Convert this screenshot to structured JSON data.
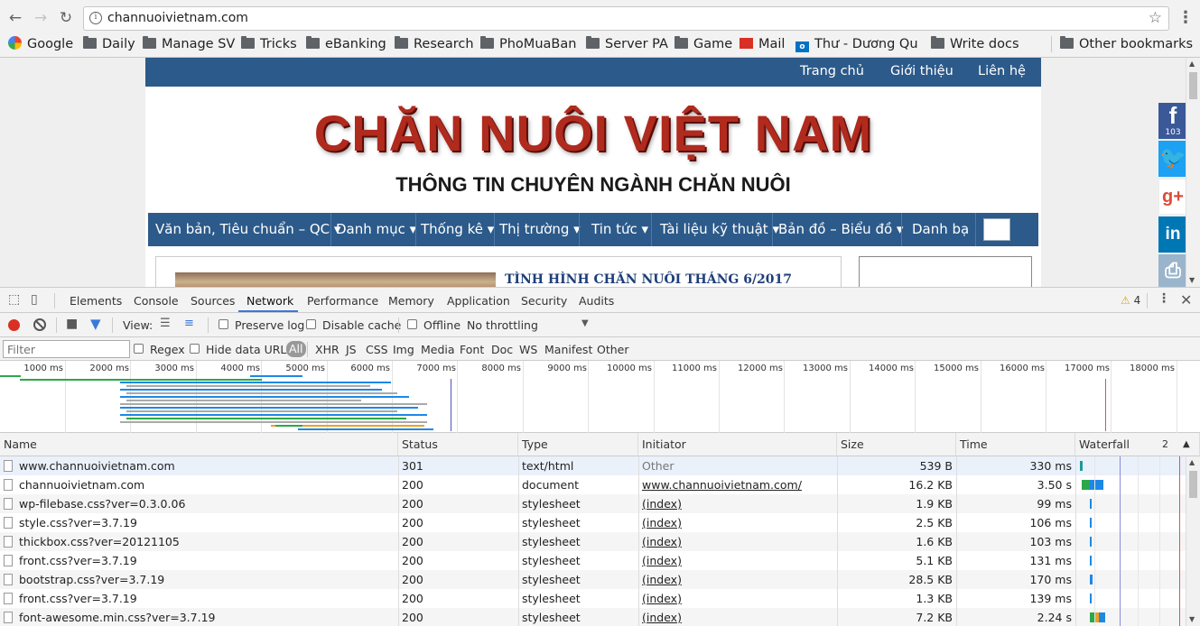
{
  "browser": {
    "url": "channuoivietnam.com",
    "bookmarks": [
      {
        "label": "Google",
        "icon": "google-icon"
      },
      {
        "label": "Daily",
        "icon": "folder-icon"
      },
      {
        "label": "Manage SV",
        "icon": "folder-icon"
      },
      {
        "label": "Tricks",
        "icon": "folder-icon"
      },
      {
        "label": "eBanking",
        "icon": "folder-icon"
      },
      {
        "label": "Research",
        "icon": "folder-icon"
      },
      {
        "label": "PhoMuaBan",
        "icon": "folder-icon"
      },
      {
        "label": "Server PA",
        "icon": "folder-icon"
      },
      {
        "label": "Game",
        "icon": "folder-icon"
      },
      {
        "label": "Mail",
        "icon": "gmail-icon"
      },
      {
        "label": "Thư - Dương Qu",
        "icon": "outlook-icon"
      },
      {
        "label": "Write docs",
        "icon": "folder-icon"
      }
    ],
    "other_bookmarks": "Other bookmarks"
  },
  "site": {
    "top_nav": [
      "Trang chủ",
      "Giới thiệu",
      "Liên hệ"
    ],
    "logo_title": "CHĂN NUÔI VIỆT NAM",
    "logo_subtitle": "THÔNG TIN CHUYÊN NGÀNH CHĂN NUÔI",
    "main_nav": [
      "Văn bản, Tiêu chuẩn – QC ▾",
      "Danh mục ▾",
      "Thống kê ▾",
      "Thị trường ▾",
      "Tin tức ▾",
      "Tài liệu kỹ thuật ▾",
      "Bản đồ – Biểu đồ ▾",
      "Danh bạ"
    ],
    "news_title": "TÌNH HÌNH CHĂN NUÔI THÁNG 6/2017",
    "social": {
      "facebook_count": "103"
    }
  },
  "devtools": {
    "tabs": [
      "Elements",
      "Console",
      "Sources",
      "Network",
      "Performance",
      "Memory",
      "Application",
      "Security",
      "Audits"
    ],
    "active_tab": "Network",
    "warning_count": "4",
    "toolbar": {
      "view_label": "View:",
      "preserve_log": "Preserve log",
      "disable_cache": "Disable cache",
      "offline": "Offline",
      "throttling": "No throttling"
    },
    "filter": {
      "placeholder": "Filter",
      "regex": "Regex",
      "hide_data_urls": "Hide data URLs",
      "types": [
        "All",
        "XHR",
        "JS",
        "CSS",
        "Img",
        "Media",
        "Font",
        "Doc",
        "WS",
        "Manifest",
        "Other"
      ]
    },
    "overview_ticks": [
      "1000 ms",
      "2000 ms",
      "3000 ms",
      "4000 ms",
      "5000 ms",
      "6000 ms",
      "7000 ms",
      "8000 ms",
      "9000 ms",
      "10000 ms",
      "11000 ms",
      "12000 ms",
      "13000 ms",
      "14000 ms",
      "15000 ms",
      "16000 ms",
      "17000 ms",
      "18000 ms"
    ],
    "columns": [
      "Name",
      "Status",
      "Type",
      "Initiator",
      "Size",
      "Time",
      "Waterfall"
    ],
    "waterfall_sort_label": "2",
    "requests": [
      {
        "name": "www.channuoivietnam.com",
        "status": "301",
        "type": "text/html",
        "initiator": "Other",
        "size": "539 B",
        "time": "330 ms"
      },
      {
        "name": "channuoivietnam.com",
        "status": "200",
        "type": "document",
        "initiator": "www.channuoivietnam.com/",
        "size": "16.2 KB",
        "time": "3.50 s"
      },
      {
        "name": "wp-filebase.css?ver=0.3.0.06",
        "status": "200",
        "type": "stylesheet",
        "initiator": "(index)",
        "size": "1.9 KB",
        "time": "99 ms"
      },
      {
        "name": "style.css?ver=3.7.19",
        "status": "200",
        "type": "stylesheet",
        "initiator": "(index)",
        "size": "2.5 KB",
        "time": "106 ms"
      },
      {
        "name": "thickbox.css?ver=20121105",
        "status": "200",
        "type": "stylesheet",
        "initiator": "(index)",
        "size": "1.6 KB",
        "time": "103 ms"
      },
      {
        "name": "front.css?ver=3.7.19",
        "status": "200",
        "type": "stylesheet",
        "initiator": "(index)",
        "size": "5.1 KB",
        "time": "131 ms"
      },
      {
        "name": "bootstrap.css?ver=3.7.19",
        "status": "200",
        "type": "stylesheet",
        "initiator": "(index)",
        "size": "28.5 KB",
        "time": "170 ms"
      },
      {
        "name": "front.css?ver=3.7.19",
        "status": "200",
        "type": "stylesheet",
        "initiator": "(index)",
        "size": "1.3 KB",
        "time": "139 ms"
      },
      {
        "name": "font-awesome.min.css?ver=3.7.19",
        "status": "200",
        "type": "stylesheet",
        "initiator": "(index)",
        "size": "7.2 KB",
        "time": "2.24 s"
      }
    ]
  }
}
